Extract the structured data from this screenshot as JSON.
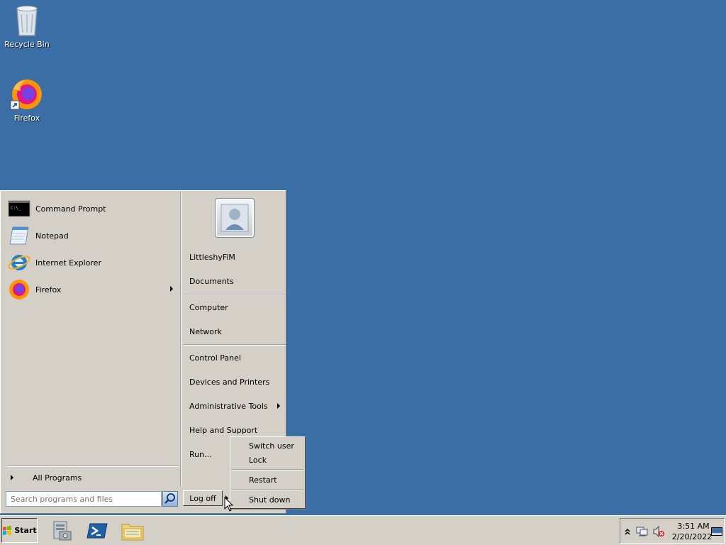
{
  "desktop": {
    "icons": [
      {
        "label": "Recycle Bin",
        "icon": "recycle-bin-icon"
      },
      {
        "label": "Firefox",
        "icon": "firefox-icon"
      }
    ]
  },
  "start_menu": {
    "pinned": [
      {
        "label": "Command Prompt",
        "icon": "command-prompt-icon"
      },
      {
        "label": "Notepad",
        "icon": "notepad-icon"
      },
      {
        "label": "Internet Explorer",
        "icon": "internet-explorer-icon"
      },
      {
        "label": "Firefox",
        "icon": "firefox-icon",
        "has_submenu": true
      }
    ],
    "all_programs": "All Programs",
    "search_placeholder": "Search programs and files",
    "right_items": {
      "user": "LittleshyFiM",
      "documents": "Documents",
      "computer": "Computer",
      "network": "Network",
      "control_panel": "Control Panel",
      "devices": "Devices and Printers",
      "admin_tools": "Administrative Tools",
      "help": "Help and Support",
      "run": "Run..."
    },
    "logoff": "Log off",
    "flyout": {
      "switch_user": "Switch user",
      "lock": "Lock",
      "restart": "Restart",
      "shut_down": "Shut down"
    }
  },
  "taskbar": {
    "start_label": "Start",
    "apps": [
      {
        "icon": "server-manager-icon"
      },
      {
        "icon": "powershell-icon"
      },
      {
        "icon": "file-explorer-icon"
      }
    ],
    "clock_time": "3:51 AM",
    "clock_date": "2/20/2022"
  },
  "colors": {
    "desktop": "#3a6ea5",
    "menu": "#d4d0c8"
  }
}
